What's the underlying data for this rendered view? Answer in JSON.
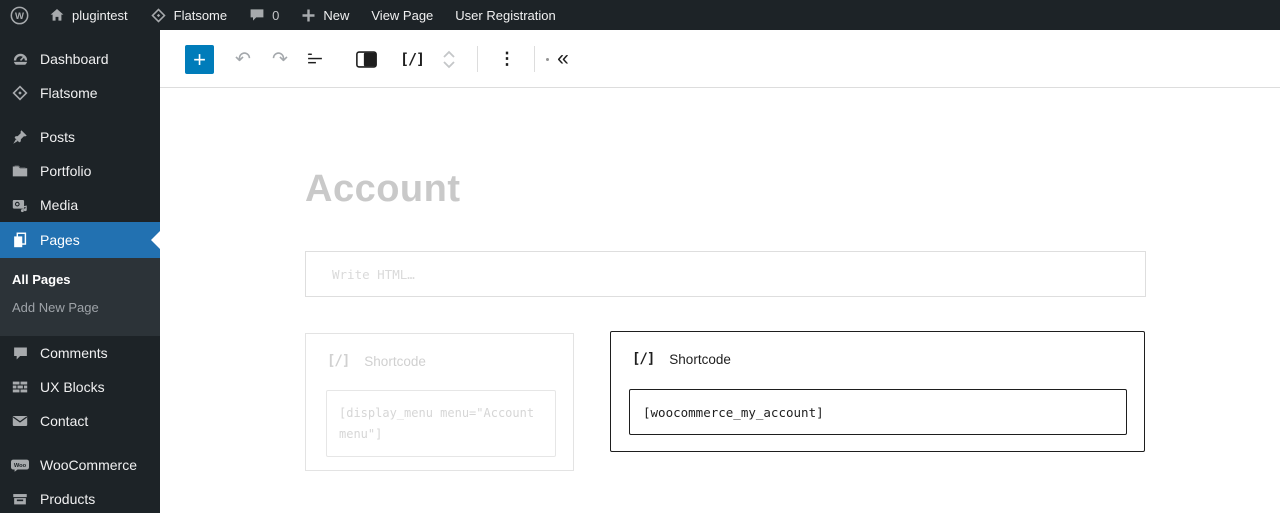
{
  "admin_bar": {
    "site_name": "plugintest",
    "theme_name": "Flatsome",
    "comment_count": "0",
    "new_label": "New",
    "view_page_label": "View Page",
    "user_registration_label": "User Registration"
  },
  "sidebar": {
    "items": [
      {
        "label": "Dashboard"
      },
      {
        "label": "Flatsome"
      },
      {
        "label": "Posts"
      },
      {
        "label": "Portfolio"
      },
      {
        "label": "Media"
      },
      {
        "label": "Pages",
        "active": true
      },
      {
        "label": "Comments"
      },
      {
        "label": "UX Blocks"
      },
      {
        "label": "Contact"
      },
      {
        "label": "WooCommerce"
      },
      {
        "label": "Products"
      }
    ],
    "pages_submenu": [
      {
        "label": "All Pages",
        "current": true
      },
      {
        "label": "Add New Page"
      }
    ]
  },
  "toolbar": {
    "icons": {
      "inserter": "+",
      "undo": "↶",
      "redo": "↷",
      "drag_dot": "·",
      "shortcode": "[/]",
      "options": "⋮",
      "collapse": "«"
    }
  },
  "editor": {
    "title": "Account",
    "html_block": {
      "placeholder": "Write HTML…"
    },
    "shortcode_blocks": [
      {
        "label": "Shortcode",
        "value": "[display_menu menu=\"Account menu\"]",
        "selected": false
      },
      {
        "label": "Shortcode",
        "value": "[woocommerce_my_account]",
        "selected": true
      }
    ]
  },
  "icons_text": {
    "wp_w": "W",
    "woo_badge": "Woo"
  },
  "colors": {
    "adminbar_bg": "#1d2327",
    "sidebar_bg": "#1d2327",
    "submenu_bg": "#2c3338",
    "active_blue": "#2271b1",
    "inserter_blue": "#007cba",
    "selected_border": "#1e1e1e",
    "dim_gray": "#d0d0d0",
    "icon_gray": "#a7aaad"
  }
}
